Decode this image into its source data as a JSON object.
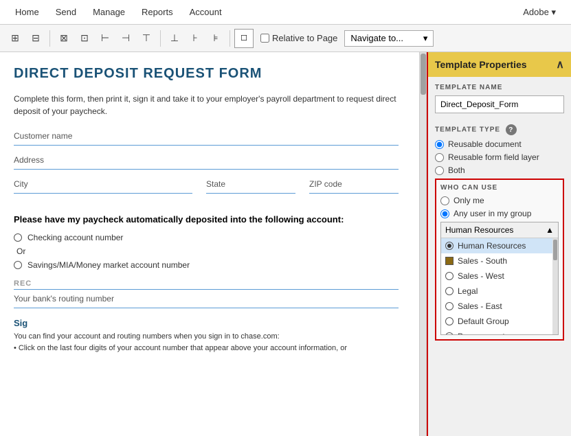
{
  "menu": {
    "items": [
      "Home",
      "Send",
      "Manage",
      "Reports",
      "Account"
    ],
    "adobe_label": "Adobe ▾"
  },
  "toolbar": {
    "relative_to_page_label": "Relative to Page",
    "navigate_label": "Navigate to...",
    "icons": [
      "⊞",
      "⊟",
      "⊠",
      "⊡",
      "⊢",
      "⊣",
      "⊤",
      "⊥",
      "⊦"
    ]
  },
  "doc": {
    "title": "DIRECT DEPOSIT REQUEST FORM",
    "description": "Complete this form, then print it, sign it and take it to your employer's payroll department to request direct deposit\nof your paycheck.",
    "field_customer_name": "Customer name",
    "field_address": "Address",
    "field_city": "City",
    "field_state": "State",
    "field_zip": "ZIP code",
    "bold_text": "Please have my paycheck automatically deposited into the following account:",
    "radio1": "Checking account number",
    "or_text": "Or",
    "radio2": "Savings/MIA/Money market account number",
    "rec_label": "REC",
    "routing_label": "Your bank's routing number",
    "sig_label": "Sig",
    "small_text1": "You can find your account and routing numbers when you sign in to chase.com:",
    "small_text2": "• Click on the last four digits of your account number that appear above your account information, or"
  },
  "panel": {
    "header_title": "Template Properties",
    "close_icon": "∧",
    "template_name_label": "TEMPLATE NAME",
    "template_name_value": "Direct_Deposit_Form",
    "template_type_label": "TEMPLATE TYPE",
    "template_type_options": [
      {
        "label": "Reusable document",
        "selected": true,
        "type": "filled"
      },
      {
        "label": "Reusable form field layer",
        "selected": false,
        "type": "empty"
      },
      {
        "label": "Both",
        "selected": false,
        "type": "empty"
      }
    ],
    "who_can_use_label": "WHO CAN USE",
    "who_can_use_options": [
      {
        "label": "Only me",
        "selected": false
      },
      {
        "label": "Any user in my group",
        "selected": true
      }
    ],
    "group_list_header": "Human Resources",
    "groups": [
      {
        "label": "Human Resources",
        "radio": true,
        "checkbox": false
      },
      {
        "label": "Sales - South",
        "radio": false,
        "checkbox": true
      },
      {
        "label": "Sales - West",
        "radio": false,
        "checkbox": false
      },
      {
        "label": "Legal",
        "radio": false,
        "checkbox": false
      },
      {
        "label": "Sales - East",
        "radio": false,
        "checkbox": false
      },
      {
        "label": "Default Group",
        "radio": false,
        "checkbox": false
      },
      {
        "label": "Procurement",
        "radio": false,
        "checkbox": false
      }
    ]
  }
}
